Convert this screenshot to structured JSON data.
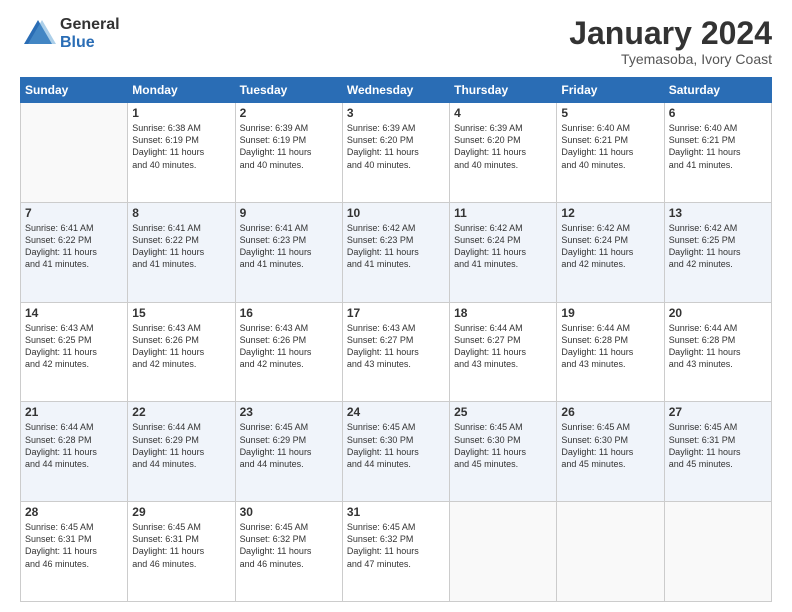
{
  "logo": {
    "general": "General",
    "blue": "Blue"
  },
  "header": {
    "month": "January 2024",
    "location": "Tyemasoba, Ivory Coast"
  },
  "weekdays": [
    "Sunday",
    "Monday",
    "Tuesday",
    "Wednesday",
    "Thursday",
    "Friday",
    "Saturday"
  ],
  "weeks": [
    [
      {
        "day": "",
        "lines": []
      },
      {
        "day": "1",
        "lines": [
          "Sunrise: 6:38 AM",
          "Sunset: 6:19 PM",
          "Daylight: 11 hours",
          "and 40 minutes."
        ]
      },
      {
        "day": "2",
        "lines": [
          "Sunrise: 6:39 AM",
          "Sunset: 6:19 PM",
          "Daylight: 11 hours",
          "and 40 minutes."
        ]
      },
      {
        "day": "3",
        "lines": [
          "Sunrise: 6:39 AM",
          "Sunset: 6:20 PM",
          "Daylight: 11 hours",
          "and 40 minutes."
        ]
      },
      {
        "day": "4",
        "lines": [
          "Sunrise: 6:39 AM",
          "Sunset: 6:20 PM",
          "Daylight: 11 hours",
          "and 40 minutes."
        ]
      },
      {
        "day": "5",
        "lines": [
          "Sunrise: 6:40 AM",
          "Sunset: 6:21 PM",
          "Daylight: 11 hours",
          "and 40 minutes."
        ]
      },
      {
        "day": "6",
        "lines": [
          "Sunrise: 6:40 AM",
          "Sunset: 6:21 PM",
          "Daylight: 11 hours",
          "and 41 minutes."
        ]
      }
    ],
    [
      {
        "day": "7",
        "lines": [
          "Sunrise: 6:41 AM",
          "Sunset: 6:22 PM",
          "Daylight: 11 hours",
          "and 41 minutes."
        ]
      },
      {
        "day": "8",
        "lines": [
          "Sunrise: 6:41 AM",
          "Sunset: 6:22 PM",
          "Daylight: 11 hours",
          "and 41 minutes."
        ]
      },
      {
        "day": "9",
        "lines": [
          "Sunrise: 6:41 AM",
          "Sunset: 6:23 PM",
          "Daylight: 11 hours",
          "and 41 minutes."
        ]
      },
      {
        "day": "10",
        "lines": [
          "Sunrise: 6:42 AM",
          "Sunset: 6:23 PM",
          "Daylight: 11 hours",
          "and 41 minutes."
        ]
      },
      {
        "day": "11",
        "lines": [
          "Sunrise: 6:42 AM",
          "Sunset: 6:24 PM",
          "Daylight: 11 hours",
          "and 41 minutes."
        ]
      },
      {
        "day": "12",
        "lines": [
          "Sunrise: 6:42 AM",
          "Sunset: 6:24 PM",
          "Daylight: 11 hours",
          "and 42 minutes."
        ]
      },
      {
        "day": "13",
        "lines": [
          "Sunrise: 6:42 AM",
          "Sunset: 6:25 PM",
          "Daylight: 11 hours",
          "and 42 minutes."
        ]
      }
    ],
    [
      {
        "day": "14",
        "lines": [
          "Sunrise: 6:43 AM",
          "Sunset: 6:25 PM",
          "Daylight: 11 hours",
          "and 42 minutes."
        ]
      },
      {
        "day": "15",
        "lines": [
          "Sunrise: 6:43 AM",
          "Sunset: 6:26 PM",
          "Daylight: 11 hours",
          "and 42 minutes."
        ]
      },
      {
        "day": "16",
        "lines": [
          "Sunrise: 6:43 AM",
          "Sunset: 6:26 PM",
          "Daylight: 11 hours",
          "and 42 minutes."
        ]
      },
      {
        "day": "17",
        "lines": [
          "Sunrise: 6:43 AM",
          "Sunset: 6:27 PM",
          "Daylight: 11 hours",
          "and 43 minutes."
        ]
      },
      {
        "day": "18",
        "lines": [
          "Sunrise: 6:44 AM",
          "Sunset: 6:27 PM",
          "Daylight: 11 hours",
          "and 43 minutes."
        ]
      },
      {
        "day": "19",
        "lines": [
          "Sunrise: 6:44 AM",
          "Sunset: 6:28 PM",
          "Daylight: 11 hours",
          "and 43 minutes."
        ]
      },
      {
        "day": "20",
        "lines": [
          "Sunrise: 6:44 AM",
          "Sunset: 6:28 PM",
          "Daylight: 11 hours",
          "and 43 minutes."
        ]
      }
    ],
    [
      {
        "day": "21",
        "lines": [
          "Sunrise: 6:44 AM",
          "Sunset: 6:28 PM",
          "Daylight: 11 hours",
          "and 44 minutes."
        ]
      },
      {
        "day": "22",
        "lines": [
          "Sunrise: 6:44 AM",
          "Sunset: 6:29 PM",
          "Daylight: 11 hours",
          "and 44 minutes."
        ]
      },
      {
        "day": "23",
        "lines": [
          "Sunrise: 6:45 AM",
          "Sunset: 6:29 PM",
          "Daylight: 11 hours",
          "and 44 minutes."
        ]
      },
      {
        "day": "24",
        "lines": [
          "Sunrise: 6:45 AM",
          "Sunset: 6:30 PM",
          "Daylight: 11 hours",
          "and 44 minutes."
        ]
      },
      {
        "day": "25",
        "lines": [
          "Sunrise: 6:45 AM",
          "Sunset: 6:30 PM",
          "Daylight: 11 hours",
          "and 45 minutes."
        ]
      },
      {
        "day": "26",
        "lines": [
          "Sunrise: 6:45 AM",
          "Sunset: 6:30 PM",
          "Daylight: 11 hours",
          "and 45 minutes."
        ]
      },
      {
        "day": "27",
        "lines": [
          "Sunrise: 6:45 AM",
          "Sunset: 6:31 PM",
          "Daylight: 11 hours",
          "and 45 minutes."
        ]
      }
    ],
    [
      {
        "day": "28",
        "lines": [
          "Sunrise: 6:45 AM",
          "Sunset: 6:31 PM",
          "Daylight: 11 hours",
          "and 46 minutes."
        ]
      },
      {
        "day": "29",
        "lines": [
          "Sunrise: 6:45 AM",
          "Sunset: 6:31 PM",
          "Daylight: 11 hours",
          "and 46 minutes."
        ]
      },
      {
        "day": "30",
        "lines": [
          "Sunrise: 6:45 AM",
          "Sunset: 6:32 PM",
          "Daylight: 11 hours",
          "and 46 minutes."
        ]
      },
      {
        "day": "31",
        "lines": [
          "Sunrise: 6:45 AM",
          "Sunset: 6:32 PM",
          "Daylight: 11 hours",
          "and 47 minutes."
        ]
      },
      {
        "day": "",
        "lines": []
      },
      {
        "day": "",
        "lines": []
      },
      {
        "day": "",
        "lines": []
      }
    ]
  ]
}
